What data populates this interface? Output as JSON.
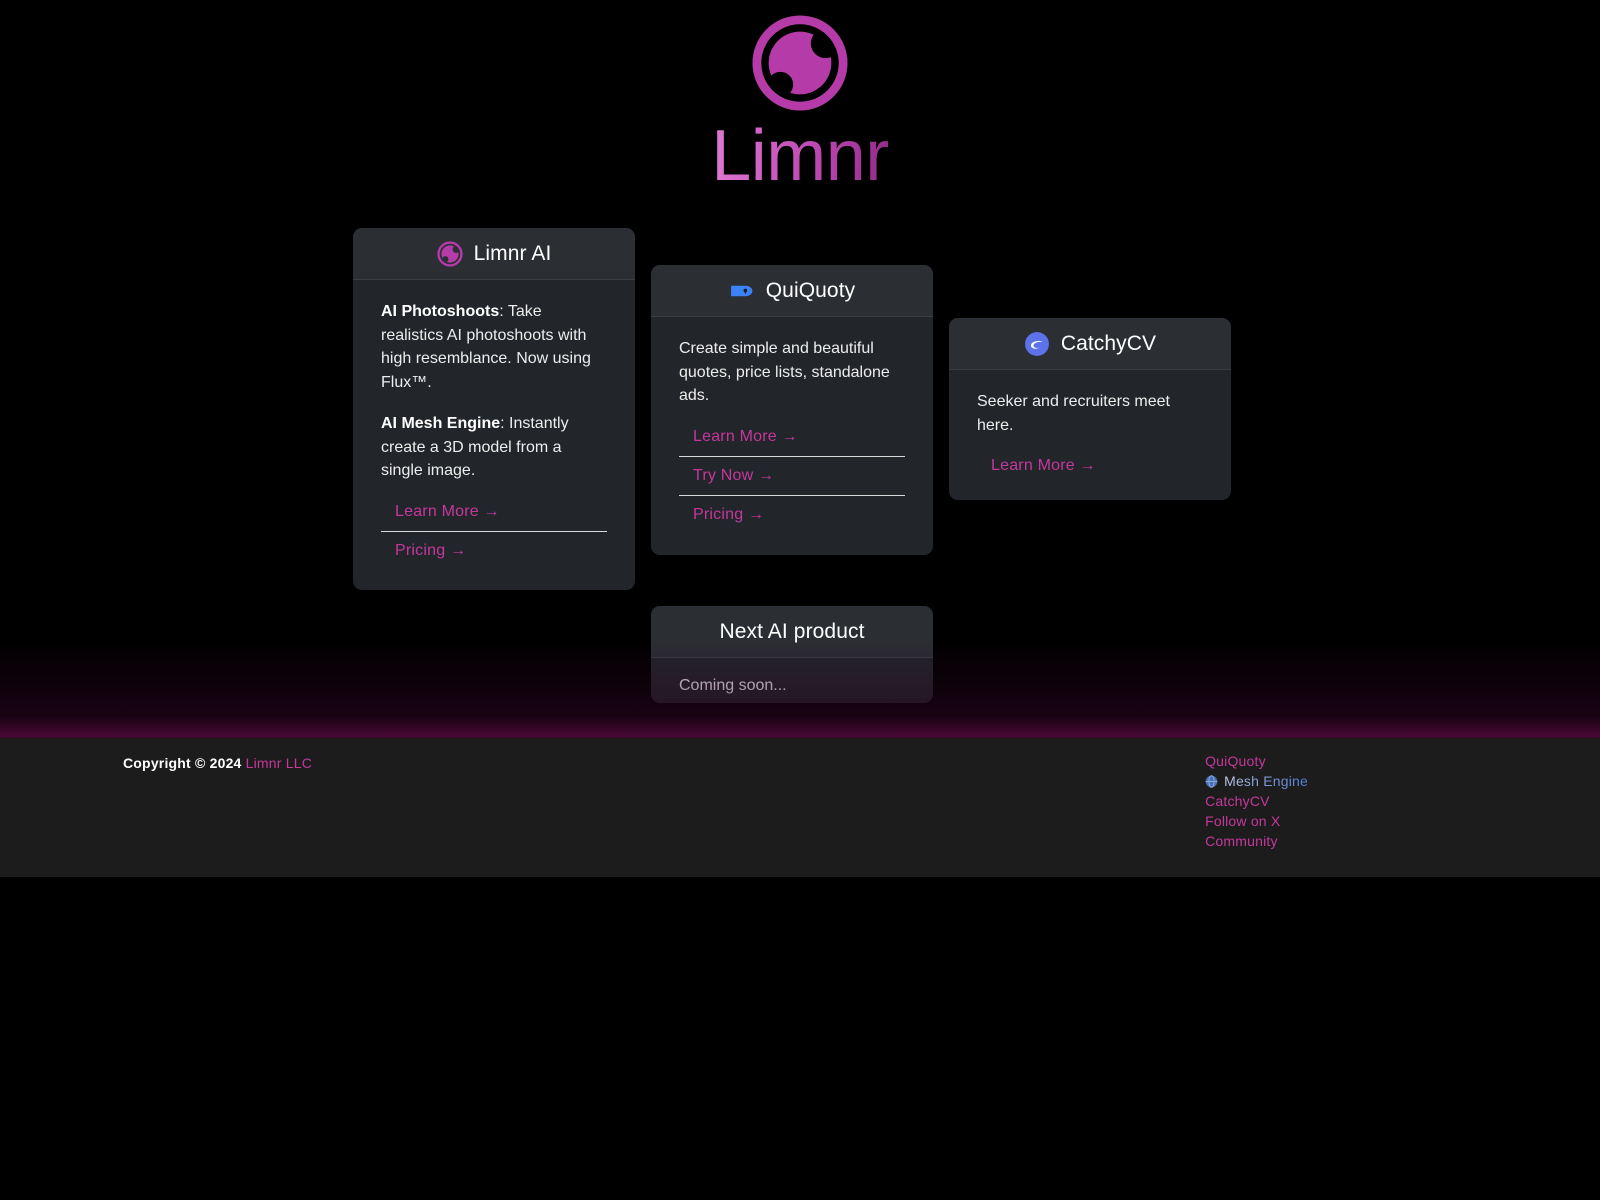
{
  "brand": {
    "name": "Limnr",
    "logo_icon": "limnr-orb-icon",
    "accent_color": "#c4389c",
    "logo_color": "#b53ca8"
  },
  "cards": [
    {
      "id": "limnr-ai",
      "title": "Limnr AI",
      "icon": "limnr-orb-icon",
      "paragraphs": [
        {
          "lead": "AI Photoshoots",
          "rest": ": Take realistics AI photoshoots with high resemblance. Now using Flux™."
        },
        {
          "lead": "AI Mesh Engine",
          "rest": ": Instantly create a 3D model from a single image."
        }
      ],
      "links": [
        "Learn More →",
        "Pricing →"
      ]
    },
    {
      "id": "quiquoty",
      "title": "QuiQuoty",
      "icon": "blue-tag-icon",
      "paragraphs": [
        {
          "lead": "",
          "rest": "Create simple and beautiful quotes, price lists, standalone ads."
        }
      ],
      "links": [
        "Learn More →",
        "Try Now →",
        "Pricing →"
      ]
    },
    {
      "id": "catchycv",
      "title": "CatchyCV",
      "icon": "blue-swoosh-circle-icon",
      "paragraphs": [
        {
          "lead": "",
          "rest": "Seeker and recruiters meet here."
        }
      ],
      "links": [
        "Learn More →"
      ]
    },
    {
      "id": "next-ai-product",
      "title": "Next AI product",
      "icon": "",
      "paragraphs": [
        {
          "lead": "",
          "rest": "Coming soon..."
        }
      ],
      "links": []
    }
  ],
  "footer": {
    "copyright_prefix": "Copyright © 2024",
    "company": "Limnr LLC",
    "links": [
      {
        "label": "QuiQuoty",
        "icon": ""
      },
      {
        "label": "Mesh Engine",
        "icon": "globe-dot-icon"
      },
      {
        "label": "CatchyCV",
        "icon": ""
      },
      {
        "label": "Follow on X",
        "icon": ""
      },
      {
        "label": "Community",
        "icon": ""
      }
    ]
  }
}
